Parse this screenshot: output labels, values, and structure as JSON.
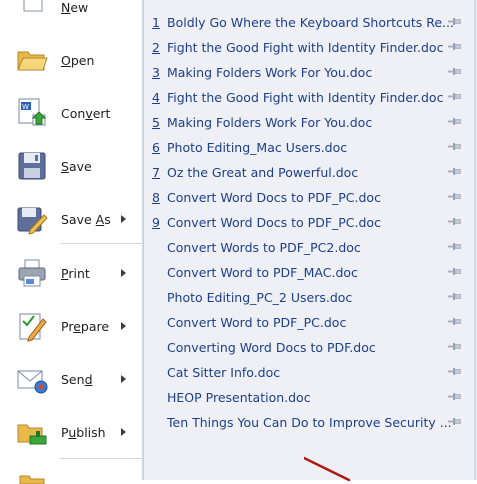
{
  "left_menu": {
    "items": [
      {
        "id": "new",
        "label": "New",
        "mnemonic": "N",
        "icon": "new-document-icon"
      },
      {
        "id": "open",
        "label": "Open",
        "mnemonic": "O",
        "icon": "folder-open-icon"
      },
      {
        "id": "convert",
        "label": "Convert",
        "mnemonic": "v",
        "icon": "convert-document-icon"
      },
      {
        "id": "save",
        "label": "Save",
        "mnemonic": "S",
        "icon": "floppy-disk-icon"
      },
      {
        "id": "save-as",
        "label": "Save As",
        "mnemonic": "A",
        "icon": "save-as-icon",
        "submenu": true
      },
      {
        "id": "print",
        "label": "Print",
        "mnemonic": "P",
        "icon": "printer-icon",
        "submenu": true
      },
      {
        "id": "prepare",
        "label": "Prepare",
        "mnemonic": "E",
        "icon": "prepare-document-icon",
        "submenu": true
      },
      {
        "id": "send",
        "label": "Send",
        "mnemonic": "D",
        "icon": "send-mail-icon",
        "submenu": true
      },
      {
        "id": "publish",
        "label": "Publish",
        "mnemonic": "U",
        "icon": "publish-folder-icon",
        "submenu": true
      }
    ]
  },
  "recent_documents": {
    "items": [
      {
        "num": "1",
        "name": "Boldly Go Where the Keyboard Shortcuts Re..."
      },
      {
        "num": "2",
        "name": "Fight the Good Fight with Identity Finder.doc"
      },
      {
        "num": "3",
        "name": "Making Folders Work For You.doc"
      },
      {
        "num": "4",
        "name": "Fight the Good Fight with Identity Finder.doc"
      },
      {
        "num": "5",
        "name": "Making Folders Work For You.doc"
      },
      {
        "num": "6",
        "name": "Photo Editing_Mac Users.doc"
      },
      {
        "num": "7",
        "name": "Oz the Great and Powerful.doc"
      },
      {
        "num": "8",
        "name": "Convert Word Docs to PDF_PC.doc"
      },
      {
        "num": "9",
        "name": "Convert Word Docs to PDF_PC.doc"
      },
      {
        "num": "",
        "name": "Convert Words to PDF_PC2.doc"
      },
      {
        "num": "",
        "name": "Convert Word to PDF_MAC.doc"
      },
      {
        "num": "",
        "name": "Photo Editing_PC_2 Users.doc"
      },
      {
        "num": "",
        "name": "Convert Word to PDF_PC.doc"
      },
      {
        "num": "",
        "name": "Converting Word Docs to PDF.doc"
      },
      {
        "num": "",
        "name": "Cat Sitter Info.doc"
      },
      {
        "num": "",
        "name": "HEOP Presentation.doc"
      },
      {
        "num": "",
        "name": "Ten Things You Can Do to Improve Security ..."
      }
    ]
  },
  "colors": {
    "doc_text": "#1c3f8a",
    "right_pane_bg": "#eef0f6",
    "annotation_arrow": "#b01818"
  }
}
